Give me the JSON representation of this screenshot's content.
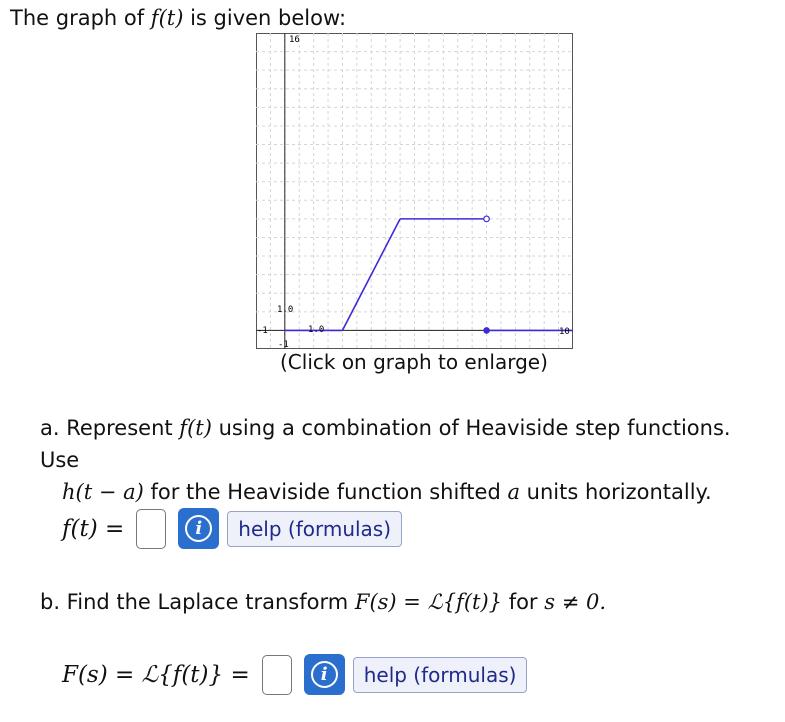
{
  "intro": {
    "pre": "The graph of ",
    "fn": "f(t)",
    "post": " is given below:"
  },
  "graph": {
    "caption": "(Click on graph to enlarge)",
    "tick_labels": {
      "x_left": "-1",
      "x_right": "10",
      "y_top": "16",
      "y_bottom": "-1",
      "x_unit": "1.0",
      "y_unit": "1.0"
    },
    "line_color": "#3b2bd9"
  },
  "chart_data": {
    "type": "line",
    "xlim": [
      -1,
      10
    ],
    "ylim": [
      -1,
      16
    ],
    "grid": true,
    "segments": [
      {
        "x": [
          0,
          2
        ],
        "y": [
          0,
          0
        ]
      },
      {
        "x": [
          2,
          4
        ],
        "y": [
          0,
          6
        ]
      },
      {
        "x": [
          4,
          7
        ],
        "y": [
          6,
          6
        ],
        "end": "open"
      },
      {
        "x": [
          7,
          10
        ],
        "y": [
          0,
          0
        ],
        "start": "closed"
      }
    ]
  },
  "part_a": {
    "line1_a": "a. Represent ",
    "line1_fn": "f(t)",
    "line1_b": " using a combination of Heaviside step functions. Use",
    "line2_fn": "h(t − a)",
    "line2_b": " for the Heaviside function shifted ",
    "line2_a": "a",
    "line2_c": " units horizontally.",
    "answer_label": "f(t) =",
    "info_icon": "info-icon",
    "help_label": "help (formulas)"
  },
  "part_b": {
    "text_a": "b. Find the Laplace transform ",
    "text_math": "F(s) = ℒ{f(t)}",
    "text_b": " for ",
    "text_cond": "s ≠ 0.",
    "answer_label": "F(s) = ℒ{f(t)} =",
    "info_icon": "info-icon",
    "help_label": "help (formulas)"
  }
}
